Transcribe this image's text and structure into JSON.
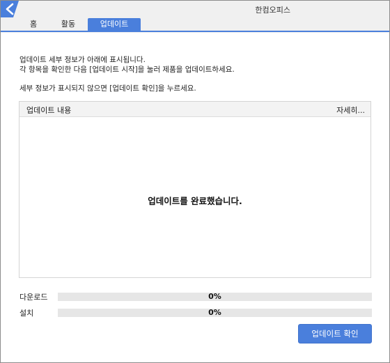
{
  "window": {
    "title": "한컴오피스",
    "logo_icon": "hancom-logo-icon",
    "accent_color": "#4a7fdc"
  },
  "tabs": [
    {
      "label": "홈",
      "active": false
    },
    {
      "label": "활동",
      "active": false
    },
    {
      "label": "업데이트",
      "active": true
    }
  ],
  "description": {
    "line1": "업데이트 세부 정보가 아래에 표시됩니다.",
    "line2": "각 항목을 확인한 다음 [업데이트 시작]을 눌러 제품을 업데이트하세요.",
    "line3": "세부 정보가 표시되지 않으면 [업데이트 확인]을 누르세요."
  },
  "update_panel": {
    "column_content": "업데이트 내용",
    "column_details": "자세히...",
    "message": "업데이트를 완료했습니다."
  },
  "progress": {
    "download": {
      "label": "다운로드",
      "value_text": "0%",
      "value": 0
    },
    "install": {
      "label": "설치",
      "value_text": "0%",
      "value": 0
    }
  },
  "buttons": {
    "check_update": "업데이트 확인"
  }
}
